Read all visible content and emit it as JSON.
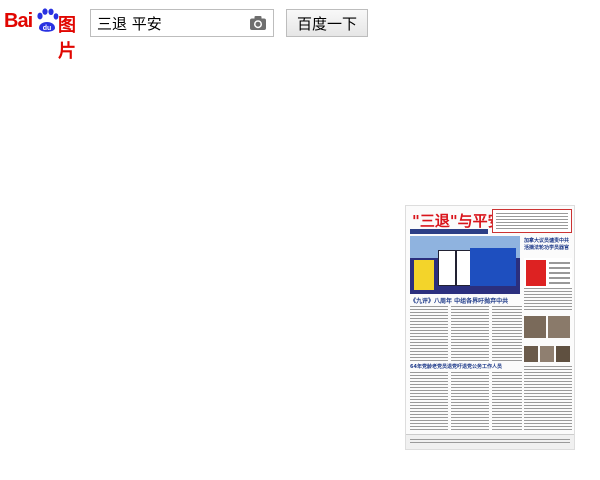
{
  "header": {
    "logo_text": "Bai",
    "logo_suffix": "图片",
    "search_value": "三退 平安",
    "search_button": "百度一下"
  },
  "result": {
    "masthead": "\"三退\"与平安",
    "headline": "《九评》八周年 中组各界吁抛弃中共",
    "subheadline": "64年党龄老党员退党吁退党公务工作人员",
    "side_title": "加拿大议员谴责中共 活摘法轮功学员器官"
  }
}
